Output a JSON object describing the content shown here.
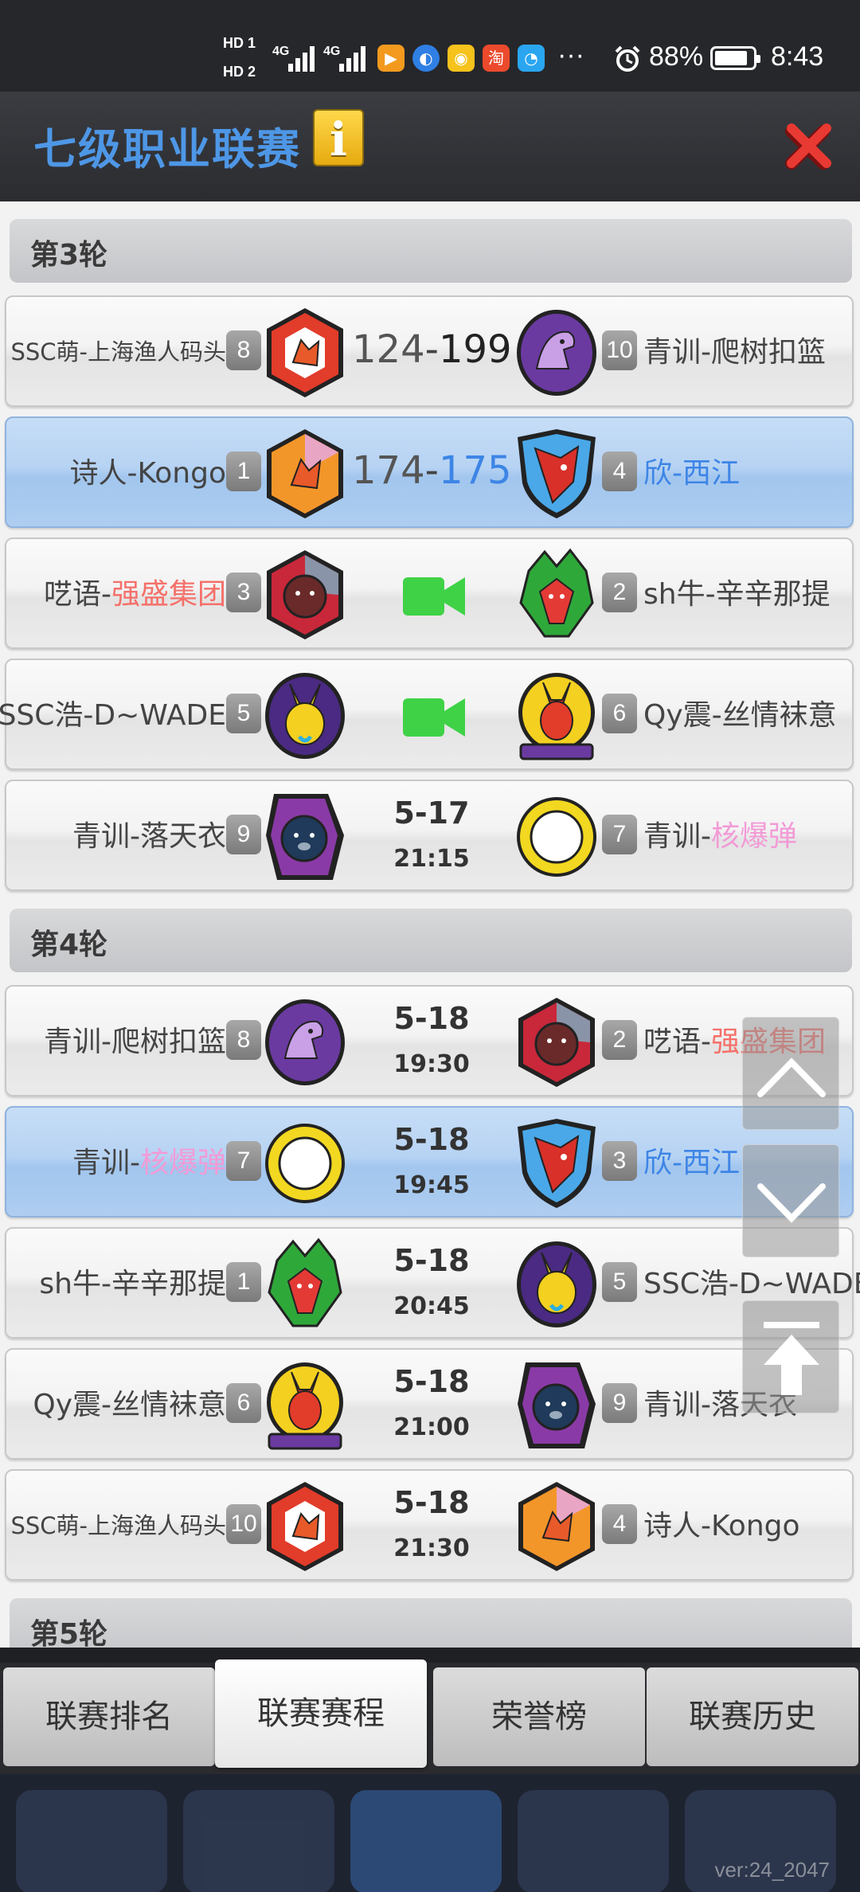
{
  "status_bar": {
    "hd1": "HD 1",
    "hd2": "HD 2",
    "net1": "4G",
    "net2": "4G",
    "more": "···",
    "battery": "88%",
    "battery_level": 0.88,
    "time": "8:43"
  },
  "header": {
    "title": "七级职业联赛",
    "info_glyph": "i"
  },
  "rounds": [
    {
      "label": "第3轮"
    },
    {
      "label": "第4轮"
    },
    {
      "label": "第5轮"
    }
  ],
  "matches": [
    {
      "home_prefix": "SSC萌-上海渔人码头",
      "home_team": "",
      "home_seed": "8",
      "away_seed": "10",
      "away_prefix": "青训-爬树扣篮",
      "away_team": "",
      "score_home": "124",
      "score_sep": "-",
      "score_away": "199"
    },
    {
      "home_prefix": "诗人-Kongo",
      "home_team": "",
      "home_seed": "1",
      "away_seed": "4",
      "away_prefix": "欣-西江",
      "away_team": "",
      "score_home": "174",
      "score_sep": "-",
      "score_away": "175"
    },
    {
      "home_prefix": "呓语-",
      "home_team": "强盛集团",
      "home_seed": "3",
      "away_seed": "2",
      "away_prefix": "sh牛-辛辛那提",
      "away_team": ""
    },
    {
      "home_prefix": "SSC浩-D~WADE",
      "home_team": "",
      "home_seed": "5",
      "away_seed": "6",
      "away_prefix": "Qy震-丝情袜意",
      "away_team": ""
    },
    {
      "home_prefix": "青训-落天衣",
      "home_team": "",
      "home_seed": "9",
      "away_seed": "7",
      "away_prefix": "青训-",
      "away_team": "核爆弹",
      "date": "5-17",
      "time": "21:15"
    },
    {
      "home_prefix": "青训-爬树扣篮",
      "home_team": "",
      "home_seed": "8",
      "away_seed": "2",
      "away_prefix": "呓语-",
      "away_team": "强盛集团",
      "date": "5-18",
      "time": "19:30"
    },
    {
      "home_prefix": "青训-",
      "home_team": "核爆弹",
      "home_seed": "7",
      "away_seed": "3",
      "away_prefix": "欣-西江",
      "away_team": "",
      "date": "5-18",
      "time": "19:45"
    },
    {
      "home_prefix": "sh牛-辛辛那提",
      "home_team": "",
      "home_seed": "1",
      "away_seed": "5",
      "away_prefix": "SSC浩-D~WADE",
      "away_team": "",
      "date": "5-18",
      "time": "20:45"
    },
    {
      "home_prefix": "Qy震-丝情袜意",
      "home_team": "",
      "home_seed": "6",
      "away_seed": "9",
      "away_prefix": "青训-落天衣",
      "away_team": "",
      "date": "5-18",
      "time": "21:00"
    },
    {
      "home_prefix": "SSC萌-上海渔人码头",
      "home_team": "",
      "home_seed": "10",
      "away_seed": "4",
      "away_prefix": "诗人-Kongo",
      "away_team": "",
      "date": "5-18",
      "time": "21:30"
    }
  ],
  "tabs": [
    {
      "label": "联赛排名"
    },
    {
      "label": "联赛赛程"
    },
    {
      "label": "荣誉榜"
    },
    {
      "label": "联赛历史"
    }
  ],
  "version": "ver:24_2047",
  "colors": {
    "title_blue": "#4e97e6",
    "highlight_row": "#b7d3f3",
    "team_red": "#f5706a",
    "team_pink": "#f29bd6",
    "team_blue": "#3d85e6",
    "video_green": "#3fd247"
  }
}
